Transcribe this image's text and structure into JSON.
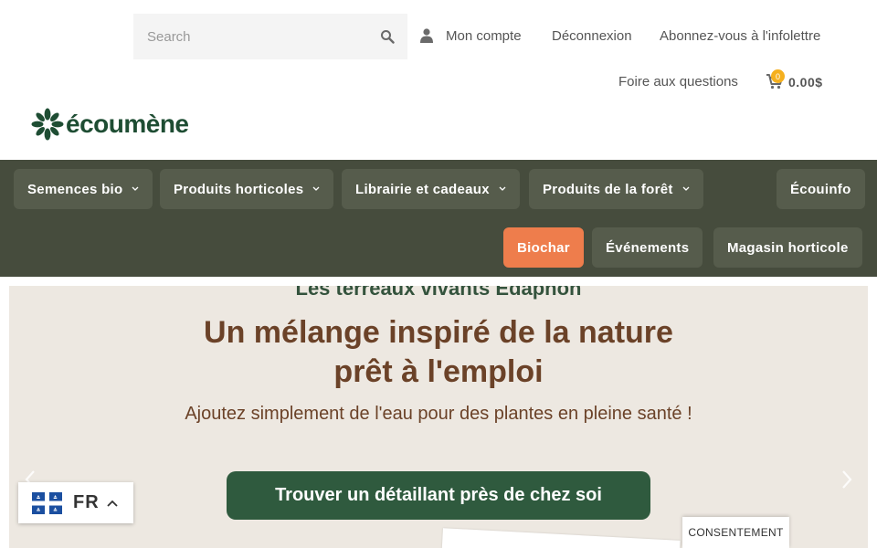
{
  "header": {
    "search_placeholder": "Search",
    "links": {
      "account": "Mon compte",
      "logout": "Déconnexion",
      "newsletter": "Abonnez-vous à l'infolettre",
      "faq": "Foire aux questions"
    },
    "cart": {
      "count": "0",
      "total": "0.00$"
    }
  },
  "logo": {
    "text": "écoumène"
  },
  "nav": {
    "row1": [
      {
        "label": "Semences bio",
        "has_dropdown": true
      },
      {
        "label": "Produits horticoles",
        "has_dropdown": true
      },
      {
        "label": "Librairie et cadeaux",
        "has_dropdown": true
      },
      {
        "label": "Produits de la forêt",
        "has_dropdown": true
      },
      {
        "label": "Écouinfo",
        "has_dropdown": false
      }
    ],
    "row2": [
      {
        "label": "Biochar",
        "active": true
      },
      {
        "label": "Événements",
        "active": false
      },
      {
        "label": "Magasin horticole",
        "active": false
      }
    ]
  },
  "hero": {
    "cut_heading": "Les terreaux vivants Édaphon",
    "heading_line1": "Un mélange inspiré de la nature",
    "heading_line2": "prêt à l'emploi",
    "subheading": "Ajoutez simplement de l'eau pour des plantes en pleine santé !",
    "cta": "Trouver un détaillant près de chez soi"
  },
  "language": {
    "code": "FR"
  },
  "consent": {
    "label": "CONSENTEMENT"
  },
  "colors": {
    "nav_bg": "#464c3d",
    "nav_item_bg": "#565c4c",
    "active_accent": "#ee7d4c",
    "brand_green": "#1e4d33",
    "hero_bg": "#ede8e1",
    "hero_text": "#6b4228",
    "cta_bg": "#2f5a3e",
    "badge": "#f5b01e"
  }
}
